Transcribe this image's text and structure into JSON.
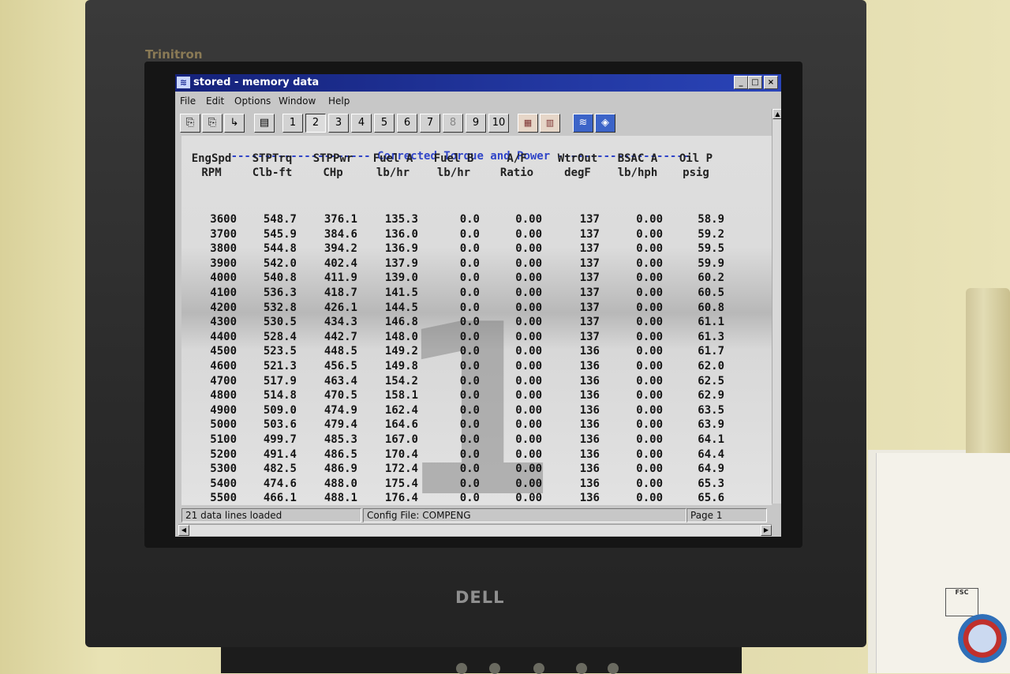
{
  "monitor": {
    "brand_top": "Trinitron",
    "brand_bottom": "DELL"
  },
  "window": {
    "title": "stored - memory data",
    "controls": {
      "minimize": "_",
      "maximize": "□",
      "close": "×"
    }
  },
  "menubar": [
    "File",
    "Edit",
    "Options",
    "Window",
    "Help"
  ],
  "toolbar": {
    "left_icons": [
      "open-icon",
      "open-multiple-icon",
      "load-icon",
      "print-icon"
    ],
    "pages": [
      "1",
      "2",
      "3",
      "4",
      "5",
      "6",
      "7",
      "8",
      "9",
      "10"
    ],
    "selected_page": "2",
    "disabled_page": "8",
    "right_icons": [
      "graph-icon",
      "edit-data-icon",
      "wave-icon",
      "stack-icon"
    ]
  },
  "table": {
    "section_title": "Corrected Torque and Power",
    "columns": [
      {
        "name": "EngSpd",
        "unit": "RPM"
      },
      {
        "name": "STPTrq",
        "unit": "Clb-ft"
      },
      {
        "name": "STPPwr",
        "unit": "CHp"
      },
      {
        "name": "Fuel A",
        "unit": "lb/hr"
      },
      {
        "name": "Fuel B",
        "unit": "lb/hr"
      },
      {
        "name": "A/F",
        "unit": "Ratio"
      },
      {
        "name": "WtrOut",
        "unit": "degF"
      },
      {
        "name": "BSAC A",
        "unit": "lb/hph"
      },
      {
        "name": "Oil P",
        "unit": "psig"
      }
    ],
    "rows": [
      [
        "3600",
        "548.7",
        "376.1",
        "135.3",
        "0.0",
        "0.00",
        "137",
        "0.00",
        "58.9"
      ],
      [
        "3700",
        "545.9",
        "384.6",
        "136.0",
        "0.0",
        "0.00",
        "137",
        "0.00",
        "59.2"
      ],
      [
        "3800",
        "544.8",
        "394.2",
        "136.9",
        "0.0",
        "0.00",
        "137",
        "0.00",
        "59.5"
      ],
      [
        "3900",
        "542.0",
        "402.4",
        "137.9",
        "0.0",
        "0.00",
        "137",
        "0.00",
        "59.9"
      ],
      [
        "4000",
        "540.8",
        "411.9",
        "139.0",
        "0.0",
        "0.00",
        "137",
        "0.00",
        "60.2"
      ],
      [
        "4100",
        "536.3",
        "418.7",
        "141.5",
        "0.0",
        "0.00",
        "137",
        "0.00",
        "60.5"
      ],
      [
        "4200",
        "532.8",
        "426.1",
        "144.5",
        "0.0",
        "0.00",
        "137",
        "0.00",
        "60.8"
      ],
      [
        "4300",
        "530.5",
        "434.3",
        "146.8",
        "0.0",
        "0.00",
        "137",
        "0.00",
        "61.1"
      ],
      [
        "4400",
        "528.4",
        "442.7",
        "148.0",
        "0.0",
        "0.00",
        "137",
        "0.00",
        "61.3"
      ],
      [
        "4500",
        "523.5",
        "448.5",
        "149.2",
        "0.0",
        "0.00",
        "136",
        "0.00",
        "61.7"
      ],
      [
        "4600",
        "521.3",
        "456.5",
        "149.8",
        "0.0",
        "0.00",
        "136",
        "0.00",
        "62.0"
      ],
      [
        "4700",
        "517.9",
        "463.4",
        "154.2",
        "0.0",
        "0.00",
        "136",
        "0.00",
        "62.5"
      ],
      [
        "4800",
        "514.8",
        "470.5",
        "158.1",
        "0.0",
        "0.00",
        "136",
        "0.00",
        "62.9"
      ],
      [
        "4900",
        "509.0",
        "474.9",
        "162.4",
        "0.0",
        "0.00",
        "136",
        "0.00",
        "63.5"
      ],
      [
        "5000",
        "503.6",
        "479.4",
        "164.6",
        "0.0",
        "0.00",
        "136",
        "0.00",
        "63.9"
      ],
      [
        "5100",
        "499.7",
        "485.3",
        "167.0",
        "0.0",
        "0.00",
        "136",
        "0.00",
        "64.1"
      ],
      [
        "5200",
        "491.4",
        "486.5",
        "170.4",
        "0.0",
        "0.00",
        "136",
        "0.00",
        "64.4"
      ],
      [
        "5300",
        "482.5",
        "486.9",
        "172.4",
        "0.0",
        "0.00",
        "136",
        "0.00",
        "64.9"
      ],
      [
        "5400",
        "474.6",
        "488.0",
        "175.4",
        "0.0",
        "0.00",
        "136",
        "0.00",
        "65.3"
      ],
      [
        "5500",
        "466.1",
        "488.1",
        "176.4",
        "0.0",
        "0.00",
        "136",
        "0.00",
        "65.6"
      ]
    ],
    "watermark": "1"
  },
  "statusbar": {
    "lines": "21 data lines loaded",
    "config": "Config File: COMPENG",
    "page": "Page 1"
  },
  "colors": {
    "titlebar": "#15227a",
    "section_title": "#3045c8",
    "chrome": "#c7c7c7"
  }
}
